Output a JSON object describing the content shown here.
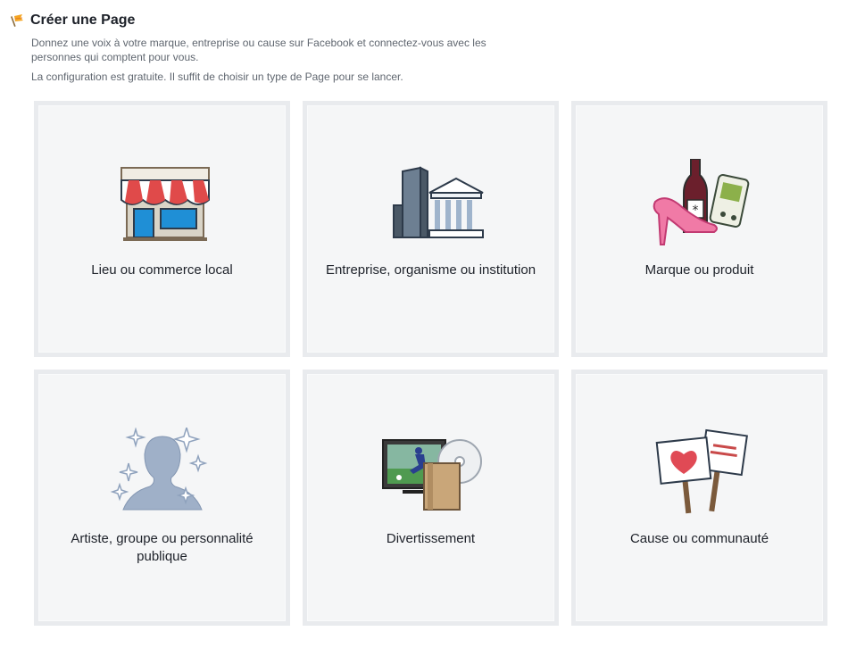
{
  "header": {
    "title": "Créer une Page",
    "description_1": "Donnez une voix à votre marque, entreprise ou cause sur Facebook et connectez-vous avec les personnes qui comptent pour vous.",
    "description_2": "La configuration est gratuite. Il suffit de choisir un type de Page pour se lancer."
  },
  "categories": [
    {
      "label": "Lieu ou commerce local",
      "icon": "storefront-icon"
    },
    {
      "label": "Entreprise, organisme ou institution",
      "icon": "buildings-icon"
    },
    {
      "label": "Marque ou produit",
      "icon": "products-icon"
    },
    {
      "label": "Artiste, groupe ou personnalité publique",
      "icon": "artist-silhouette-icon"
    },
    {
      "label": "Divertissement",
      "icon": "entertainment-icon"
    },
    {
      "label": "Cause ou communauté",
      "icon": "protest-signs-icon"
    }
  ]
}
